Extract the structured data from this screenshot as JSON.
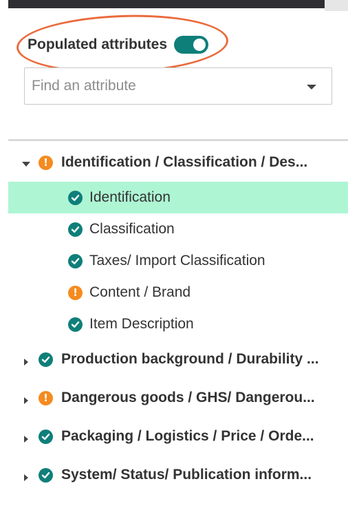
{
  "filter": {
    "toggle_label": "Populated attributes",
    "toggle_on": true
  },
  "search": {
    "placeholder": "Find an attribute"
  },
  "tree": {
    "groups": [
      {
        "label": "Identification / Classification / Des...",
        "status": "warning",
        "expanded": true,
        "children": [
          {
            "label": "Identification",
            "status": "complete",
            "selected": true
          },
          {
            "label": "Classification",
            "status": "complete"
          },
          {
            "label": "Taxes/ Import Classification",
            "status": "complete"
          },
          {
            "label": "Content / Brand",
            "status": "warning"
          },
          {
            "label": "Item Description",
            "status": "complete"
          }
        ]
      },
      {
        "label": "Production background / Durability ...",
        "status": "complete",
        "expanded": false
      },
      {
        "label": "Dangerous goods / GHS/ Dangerou...",
        "status": "warning",
        "expanded": false
      },
      {
        "label": "Packaging / Logistics / Price / Orde...",
        "status": "complete",
        "expanded": false
      },
      {
        "label": "System/ Status/ Publication inform...",
        "status": "complete",
        "expanded": false
      }
    ]
  },
  "colors": {
    "accent": "#0f7f79",
    "warning": "#f58b1f",
    "selected_row": "#aef5d4",
    "annotation": "#ea6b3c"
  }
}
